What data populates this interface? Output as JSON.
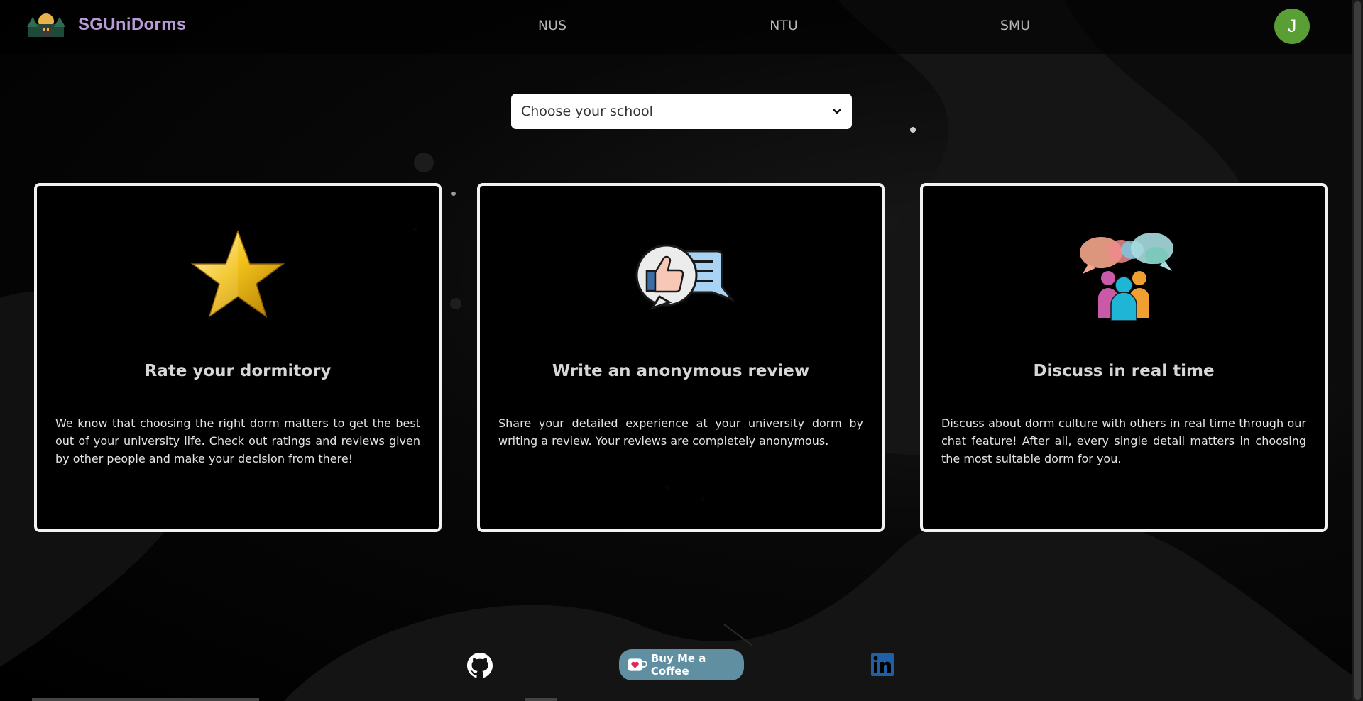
{
  "navbar": {
    "brand_name": "SGUniDorms",
    "links": [
      {
        "label": "NUS"
      },
      {
        "label": "NTU"
      },
      {
        "label": "SMU"
      }
    ],
    "avatar_initial": "J",
    "avatar_color": "#5a9f36",
    "brand_color": "#b99bd6"
  },
  "school_select": {
    "selected": "Choose your school"
  },
  "cards": [
    {
      "icon": "star-icon",
      "title": "Rate your dormitory",
      "text": "We know that choosing the right dorm matters to get the best out of your university life. Check out ratings and reviews given by other people and make your decision from there!"
    },
    {
      "icon": "review-icon",
      "title": "Write an anonymous review",
      "text": "Share your detailed experience at your university dorm by writing a review. Your reviews are completely anonymous."
    },
    {
      "icon": "discussion-icon",
      "title": "Discuss in real time",
      "text": "Discuss about dorm culture with others in real time through our chat feature! After all, every single detail matters in choosing the most suitable dorm for you."
    }
  ],
  "footer": {
    "github_icon": "github-icon",
    "coffee_label": "Buy Me a Coffee",
    "coffee_color": "#5f8fa0",
    "linkedin_icon": "linkedin-icon"
  }
}
